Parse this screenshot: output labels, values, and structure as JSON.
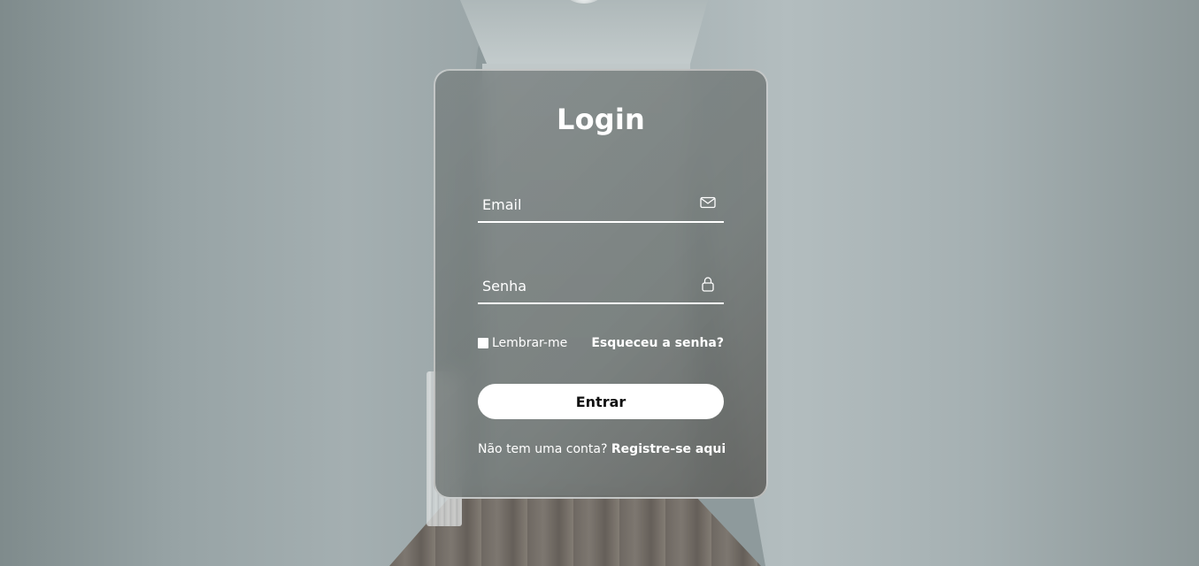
{
  "login": {
    "title": "Login",
    "email": {
      "placeholder": "Email",
      "value": "",
      "icon": "mail-icon"
    },
    "password": {
      "placeholder": "Senha",
      "value": "",
      "icon": "lock-icon"
    },
    "remember_label": "Lembrar-me",
    "remember_checked": false,
    "forgot_label": "Esqueceu a senha?",
    "submit_label": "Entrar",
    "register_prompt": "Não tem uma conta?",
    "register_link": "Registre-se aqui"
  },
  "colors": {
    "card_border": "#ffffff",
    "button_bg": "#ffffff",
    "button_text": "#111111",
    "text": "#ffffff"
  }
}
